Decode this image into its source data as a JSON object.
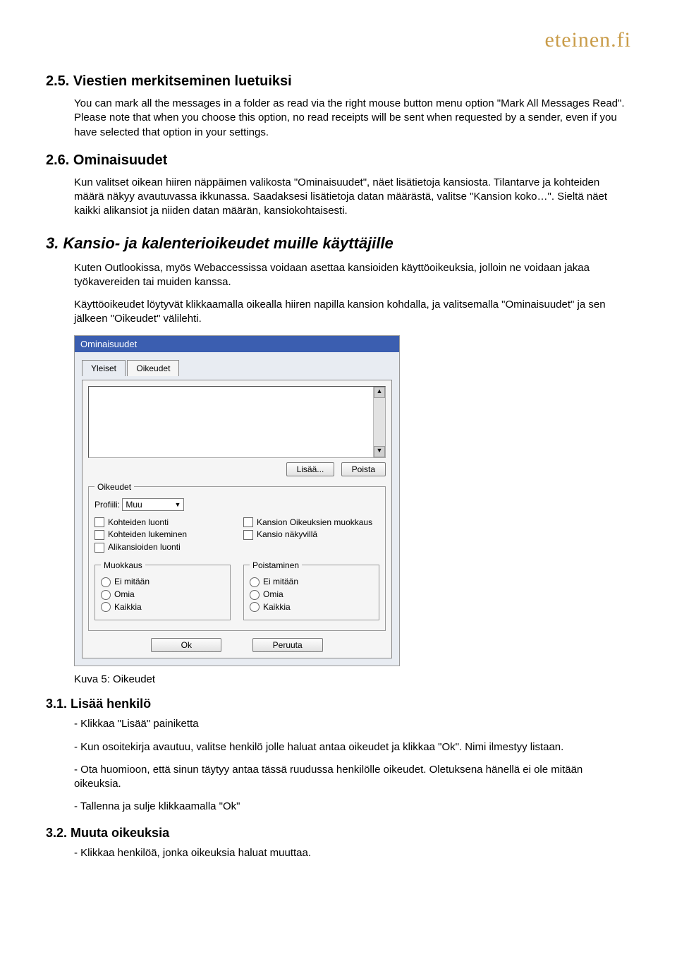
{
  "logo": "eteinen.fi",
  "s25": {
    "num": "2.5.",
    "title": "Viestien merkitseminen luetuiksi",
    "p1": "You can mark all the messages in a folder as read via the right mouse button menu option \"Mark All Messages Read\". Please note that when you choose this option, no read receipts will be sent when requested by a sender, even if you have selected that option in your settings."
  },
  "s26": {
    "num": "2.6.",
    "title": "Ominaisuudet",
    "p1": "Kun valitset oikean hiiren näppäimen valikosta \"Ominaisuudet\", näet lisätietoja kansiosta. Tilantarve ja kohteiden määrä näkyy avautuvassa ikkunassa. Saadaksesi lisätietoja datan määrästä, valitse \"Kansion koko…\". Sieltä näet kaikki alikansiot ja niiden datan määrän, kansiokohtaisesti."
  },
  "s3": {
    "num": "3.",
    "title": "Kansio- ja kalenterioikeudet muille käyttäjille",
    "p1": "Kuten Outlookissa, myös Webaccessissa voidaan asettaa kansioiden käyttöoikeuksia, jolloin ne voidaan jakaa työkavereiden tai muiden kanssa.",
    "p2": "Käyttöoikeudet löytyvät klikkaamalla oikealla hiiren napilla kansion kohdalla, ja valitsemalla \"Ominaisuudet\" ja sen jälkeen \"Oikeudet\" välilehti."
  },
  "dialog": {
    "title": "Ominaisuudet",
    "tabs": {
      "yleiset": "Yleiset",
      "oikeudet": "Oikeudet"
    },
    "buttons": {
      "lisaa": "Lisää...",
      "poista": "Poista",
      "ok": "Ok",
      "peruuta": "Peruuta"
    },
    "oikeudet_legend": "Oikeudet",
    "profiili_label": "Profiili:",
    "profiili_value": "Muu",
    "checks": {
      "kohteiden_luonti": "Kohteiden luonti",
      "kohteiden_lukeminen": "Kohteiden lukeminen",
      "alikansioiden_luonti": "Alikansioiden luonti",
      "kansion_oik_muokkaus": "Kansion Oikeuksien muokkaus",
      "kansio_nakyvilla": "Kansio näkyvillä"
    },
    "muokkaus_legend": "Muokkaus",
    "poistaminen_legend": "Poistaminen",
    "radios": {
      "ei": "Ei mitään",
      "omia": "Omia",
      "kaikkia": "Kaikkia"
    }
  },
  "caption5": "Kuva 5: Oikeudet",
  "s31": {
    "num": "3.1.",
    "title": "Lisää henkilö",
    "li1": "- Klikkaa \"Lisää\" painiketta",
    "li2": "- Kun osoitekirja avautuu, valitse henkilö jolle haluat antaa oikeudet ja klikkaa \"Ok\". Nimi ilmestyy listaan.",
    "li3": "- Ota huomioon, että sinun täytyy antaa tässä ruudussa henkilölle oikeudet. Oletuksena hänellä ei ole mitään oikeuksia.",
    "li4": "- Tallenna ja sulje klikkaamalla \"Ok\""
  },
  "s32": {
    "num": "3.2.",
    "title": "Muuta oikeuksia",
    "li1": "- Klikkaa henkilöä, jonka oikeuksia haluat muuttaa."
  }
}
